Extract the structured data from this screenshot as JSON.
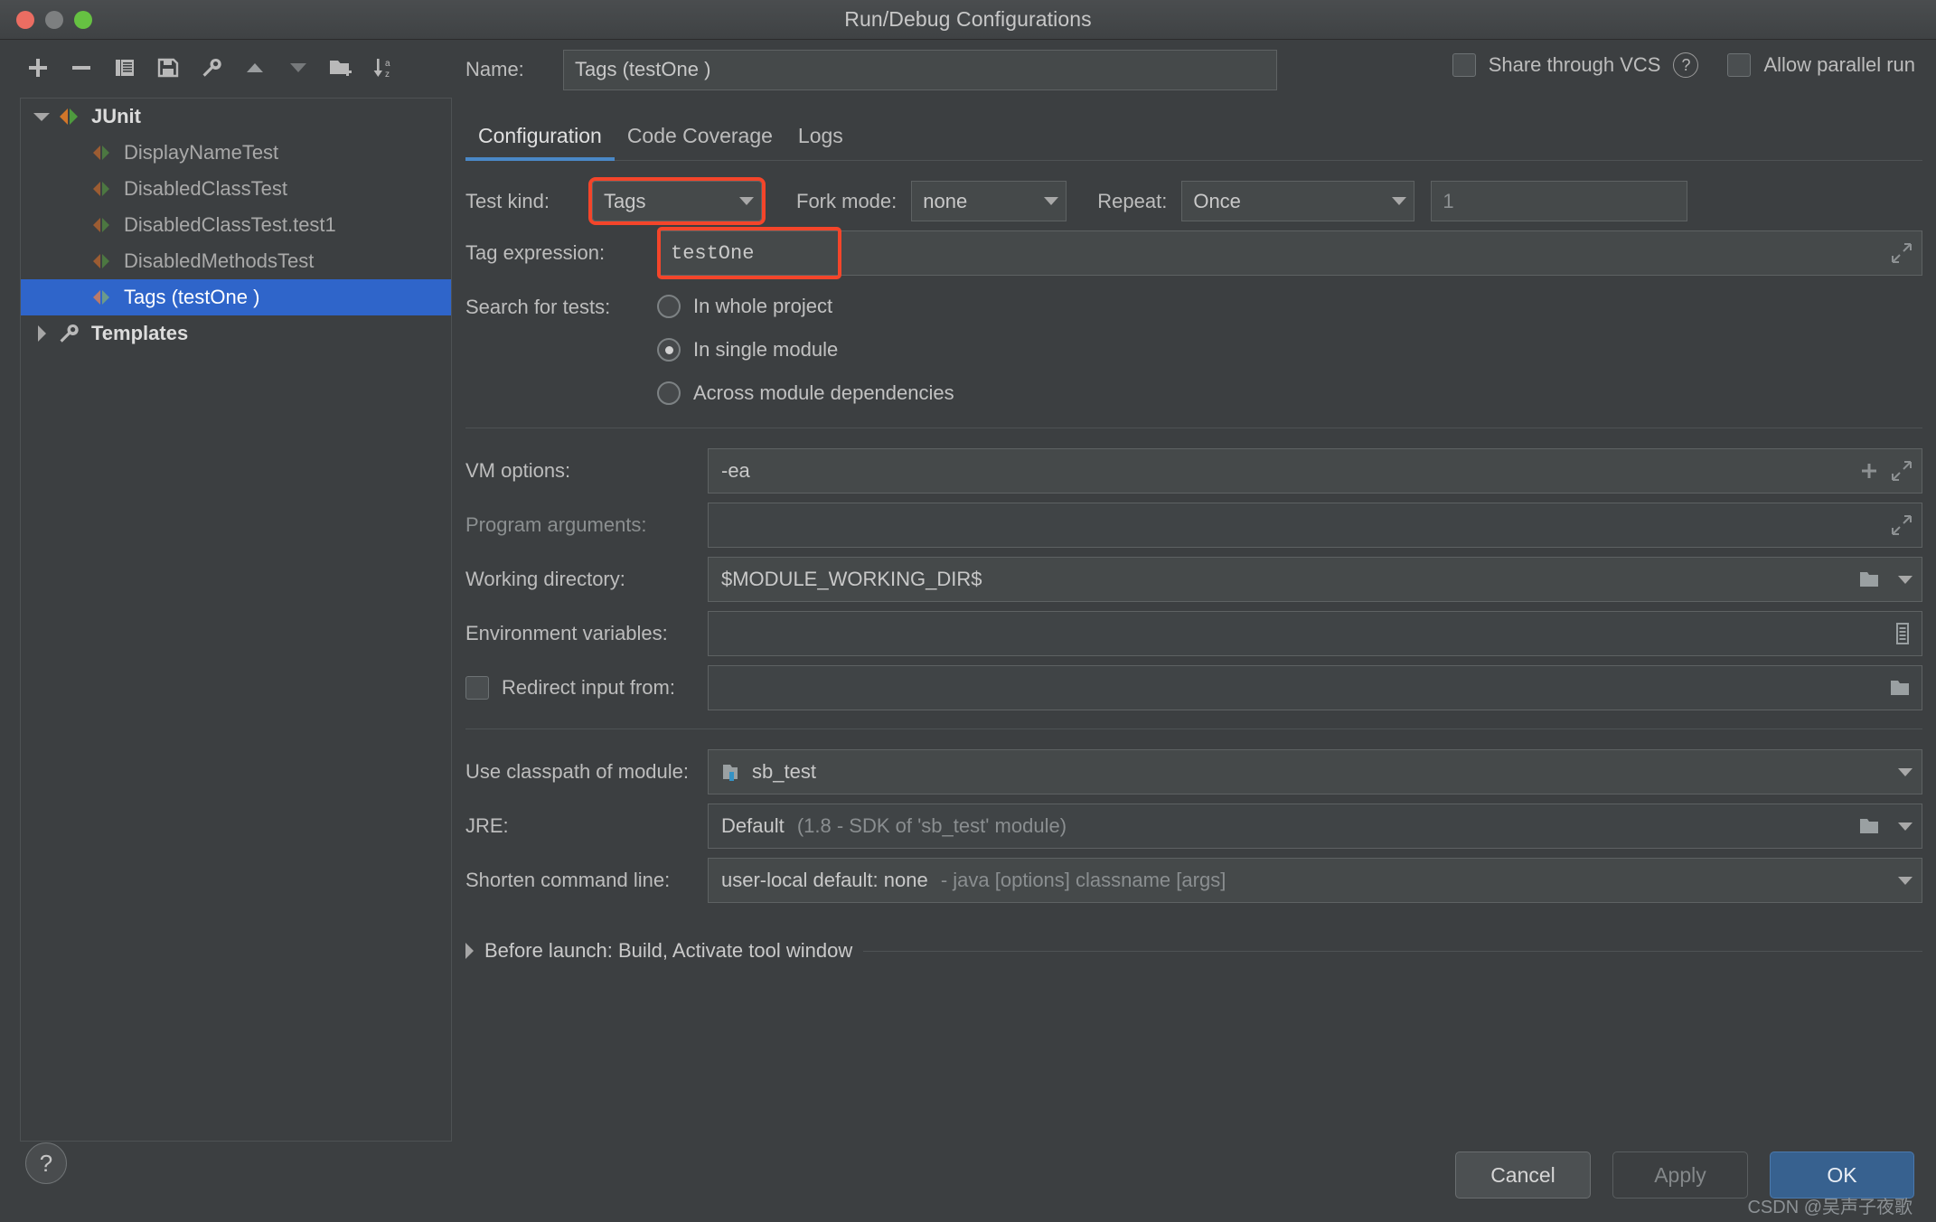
{
  "window": {
    "title": "Run/Debug Configurations",
    "traffic_lights": [
      "close",
      "minimize",
      "zoom"
    ]
  },
  "toolbar": {
    "buttons": [
      {
        "name": "add-configuration",
        "icon": "plus-icon"
      },
      {
        "name": "remove-configuration",
        "icon": "minus-icon"
      },
      {
        "name": "copy-configuration",
        "icon": "copy-icon"
      },
      {
        "name": "save-configuration",
        "icon": "save-icon"
      },
      {
        "name": "edit-templates",
        "icon": "wrench-icon"
      },
      {
        "name": "move-up",
        "icon": "triangle-up-icon"
      },
      {
        "name": "move-down",
        "icon": "triangle-down-icon"
      },
      {
        "name": "move-into-folder",
        "icon": "folder-add-icon"
      },
      {
        "name": "sort-alphabetically",
        "icon": "sort-az-icon"
      }
    ]
  },
  "tree": [
    {
      "label": "JUnit",
      "level": 0,
      "expanded": true,
      "icon": "junit-icon",
      "selected": false
    },
    {
      "label": "DisplayNameTest",
      "level": 1,
      "icon": "junit-icon",
      "selected": false
    },
    {
      "label": "DisabledClassTest",
      "level": 1,
      "icon": "junit-icon",
      "selected": false
    },
    {
      "label": "DisabledClassTest.test1",
      "level": 1,
      "icon": "junit-icon",
      "selected": false
    },
    {
      "label": "DisabledMethodsTest",
      "level": 1,
      "icon": "junit-icon",
      "selected": false
    },
    {
      "label": "Tags (testOne )",
      "level": 1,
      "icon": "junit-icon",
      "selected": true
    },
    {
      "label": "Templates",
      "level": 0,
      "expanded": false,
      "icon": "wrench-icon",
      "selected": false
    }
  ],
  "header": {
    "name_label": "Name:",
    "name_value": "Tags (testOne )",
    "share_through_vcs_label": "Share through VCS",
    "share_through_vcs_checked": false,
    "vcs_help_icon": "question-mark-icon",
    "allow_parallel_run_label": "Allow parallel run",
    "allow_parallel_run_checked": false
  },
  "tabs": [
    {
      "label": "Configuration",
      "active": true
    },
    {
      "label": "Code Coverage",
      "active": false
    },
    {
      "label": "Logs",
      "active": false
    }
  ],
  "config": {
    "test_kind_label": "Test kind:",
    "test_kind_value": "Tags",
    "fork_mode_label": "Fork mode:",
    "fork_mode_value": "none",
    "repeat_label": "Repeat:",
    "repeat_value": "Once",
    "repeat_count_value": "1",
    "tag_expression_label": "Tag expression:",
    "tag_expression_value": "testOne",
    "search_for_tests_label": "Search for tests:",
    "search_options": [
      {
        "label": "In whole project",
        "selected": false
      },
      {
        "label": "In single module",
        "selected": true
      },
      {
        "label": "Across module dependencies",
        "selected": false
      }
    ],
    "vm_options_label": "VM options:",
    "vm_options_value": "-ea",
    "program_arguments_label": "Program arguments:",
    "program_arguments_value": "",
    "working_directory_label": "Working directory:",
    "working_directory_value": "$MODULE_WORKING_DIR$",
    "environment_variables_label": "Environment variables:",
    "environment_variables_value": "",
    "redirect_input_label": "Redirect input from:",
    "redirect_input_checked": false,
    "redirect_input_value": "",
    "use_classpath_label": "Use classpath of module:",
    "use_classpath_value": "sb_test",
    "jre_label": "JRE:",
    "jre_value": "Default",
    "jre_value_hint": "(1.8 - SDK of 'sb_test' module)",
    "shorten_cmdline_label": "Shorten command line:",
    "shorten_cmdline_value": "user-local default: none",
    "shorten_cmdline_hint": "- java [options] classname [args]"
  },
  "before_launch": {
    "label": "Before launch: Build, Activate tool window",
    "expanded": false
  },
  "footer": {
    "help_label": "?",
    "cancel_label": "Cancel",
    "apply_label": "Apply",
    "ok_label": "OK",
    "watermark": "CSDN @吴声子夜歌"
  },
  "colors": {
    "background": "#3c3f41",
    "selection_blue": "#2f65ca",
    "accent_blue": "#4a88c7",
    "highlight_red": "#f4452a",
    "ok_button": "#37618f"
  }
}
